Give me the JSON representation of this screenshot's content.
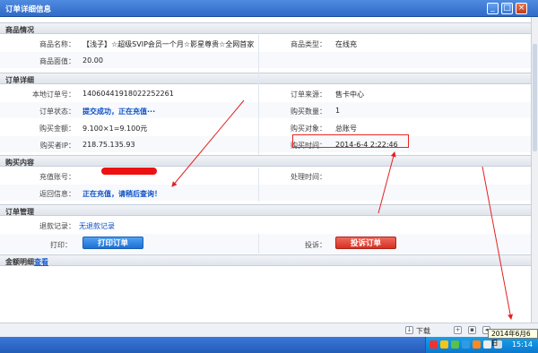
{
  "window": {
    "title": "订单详细信息",
    "minimize_glyph": "_",
    "maximize_glyph": "□",
    "close_glyph": "×"
  },
  "product": {
    "section_title": "商品情况",
    "name_label": "商品名称：",
    "name_value": "【浅子】☆超级SVIP会员一个月☆影星尊贵☆全网首家",
    "type_label": "商品类型：",
    "type_value": "在线充",
    "price_label": "商品面值：",
    "price_value": "20.00"
  },
  "order": {
    "section_title": "订单详细",
    "local_no_label": "本地订单号：",
    "local_no_value": "14060441918022252261",
    "source_label": "订单来源：",
    "source_value": "售卡中心",
    "status_label": "订单状态：",
    "status_value": "提交成功，正在充值···",
    "qty_label": "购买数量：",
    "qty_value": "1",
    "amount_label": "购买金额：",
    "amount_value": "9.100×1=9.100元",
    "target_label": "购买对象：",
    "target_value": "总账号",
    "ip_label": "购买者IP：",
    "ip_value": "218.75.135.93",
    "time_label": "购买时间：",
    "time_value": "2014-6-4 2:22:46"
  },
  "purchase": {
    "section_title": "购买内容",
    "account_label": "充值账号：",
    "process_time_label": "处理时间：",
    "return_info_label": "返回信息：",
    "return_info_value": "正在充值，请稍后查询！"
  },
  "management": {
    "section_title": "订单管理",
    "refund_label": "退款记录：",
    "refund_value": "无退款记录",
    "print_label": "打印：",
    "print_button": "打印订单",
    "complaint_label": "投诉：",
    "complaint_button": "投诉订单"
  },
  "amount_detail": {
    "section_title": "金额明细",
    "view_link": "查看"
  },
  "statusbar": {
    "download_label": "下载"
  },
  "taskbar": {
    "tooltip_date": "2014年6月6日",
    "clock": "15:14"
  },
  "colors": {
    "annotation_red": "#e22222",
    "tray_blue": "#0a78cf"
  }
}
